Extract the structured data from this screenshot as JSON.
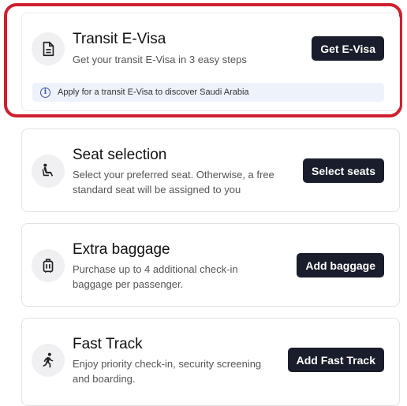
{
  "evisa": {
    "title": "Transit E-Visa",
    "description": "Get your transit E-Visa in 3 easy steps",
    "button": "Get E-Visa",
    "info": "Apply for a transit E-Visa to discover Saudi Arabia",
    "icon": "document-icon"
  },
  "seat": {
    "title": "Seat selection",
    "description": "Select your preferred seat. Otherwise, a free standard seat will be assigned to you",
    "button": "Select seats",
    "icon": "seat-icon"
  },
  "baggage": {
    "title": "Extra baggage",
    "description": "Purchase up to 4 additional check-in baggage per passenger.",
    "button": "Add baggage",
    "icon": "luggage-icon"
  },
  "fasttrack": {
    "title": "Fast Track",
    "description": "Enjoy priority check-in, security screening and boarding.",
    "button": "Add Fast Track",
    "icon": "running-person-icon"
  },
  "colors": {
    "highlight_border": "#cf1f2e",
    "button_bg": "#1a1d2b",
    "info_bg": "#eef2fb"
  }
}
